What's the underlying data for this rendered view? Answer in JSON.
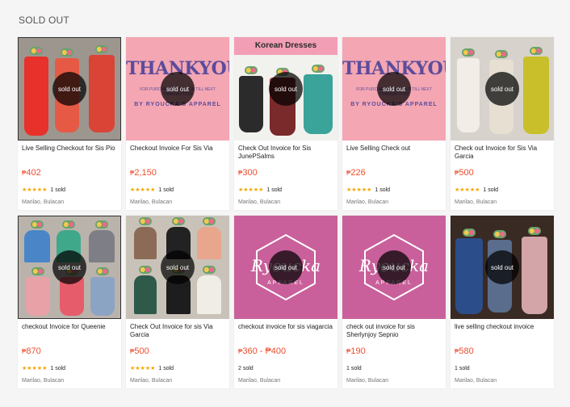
{
  "section": {
    "title": "SOLD OUT"
  },
  "sold_badge": "sold out",
  "currency_symbol": "₱",
  "stars": "★★★★★",
  "colors": {
    "price": "#ee4d2d",
    "star": "#f6a700",
    "overlay": "rgba(0,0,0,0.72)"
  },
  "products": [
    {
      "title": "Live Selling Checkout for Sis Pio",
      "price": "402",
      "rating": "5",
      "sold": "1 sold",
      "location": "Marilao, Bulacan",
      "thumb": "photo-red-dresses"
    },
    {
      "title": "Checkout Invoice For Sis Via",
      "price": "2,150",
      "rating": "5",
      "sold": "1 sold",
      "location": "Marilao, Bulacan",
      "thumb": "thankyou-banner"
    },
    {
      "title": "Check Out Invoice for Sis JunePSalms",
      "price": "300",
      "rating": "5",
      "sold": "1 sold",
      "location": "Marilao, Bulacan",
      "thumb": "korean-dresses"
    },
    {
      "title": "Live Selling Check out",
      "price": "226",
      "rating": "5",
      "sold": "1 sold",
      "location": "Marilao, Bulacan",
      "thumb": "thankyou-banner"
    },
    {
      "title": "Check out Invoice for Sis Via Garcia",
      "price": "500",
      "rating": "5",
      "sold": "1 sold",
      "location": "Marilao, Bulacan",
      "thumb": "photo-dresses"
    },
    {
      "title": "checkout Invoice for Queenie",
      "price": "870",
      "rating": "5",
      "sold": "1 sold",
      "location": "Marilao, Bulacan",
      "thumb": "photo-floral-dresses"
    },
    {
      "title": "Check Out Invoice for sis Via Garcia",
      "price": "500",
      "rating": "5",
      "sold": "1 sold",
      "location": "Marilao, Bulacan",
      "thumb": "photo-tops"
    },
    {
      "title": "checkout invoice for sis viagarcia",
      "price": "360 - ₱400",
      "rating": null,
      "sold": "2 sold",
      "location": "Marilao, Bulacan",
      "thumb": "brand-logo"
    },
    {
      "title": "check out invoice for sis Sherlynjoy Sepnio",
      "price": "190",
      "rating": null,
      "sold": "1 sold",
      "location": "Marilao, Bulacan",
      "thumb": "brand-logo"
    },
    {
      "title": "live selling checkout invoice",
      "price": "580",
      "rating": null,
      "sold": "1 sold",
      "location": "Marilao, Bulacan",
      "thumb": "photo-dark-dresses"
    }
  ],
  "thumb_text": {
    "korean": "Korean Dresses",
    "thankyou": "THANKYOU",
    "thankyou_sub": "FOR PURCHASING WITH US TILL NEXT TRANSACTION",
    "thankyou_by": "BY RYOUCKA'S APPAREL",
    "brand": "Ryoucka",
    "brand_sub": "APPAREL"
  }
}
